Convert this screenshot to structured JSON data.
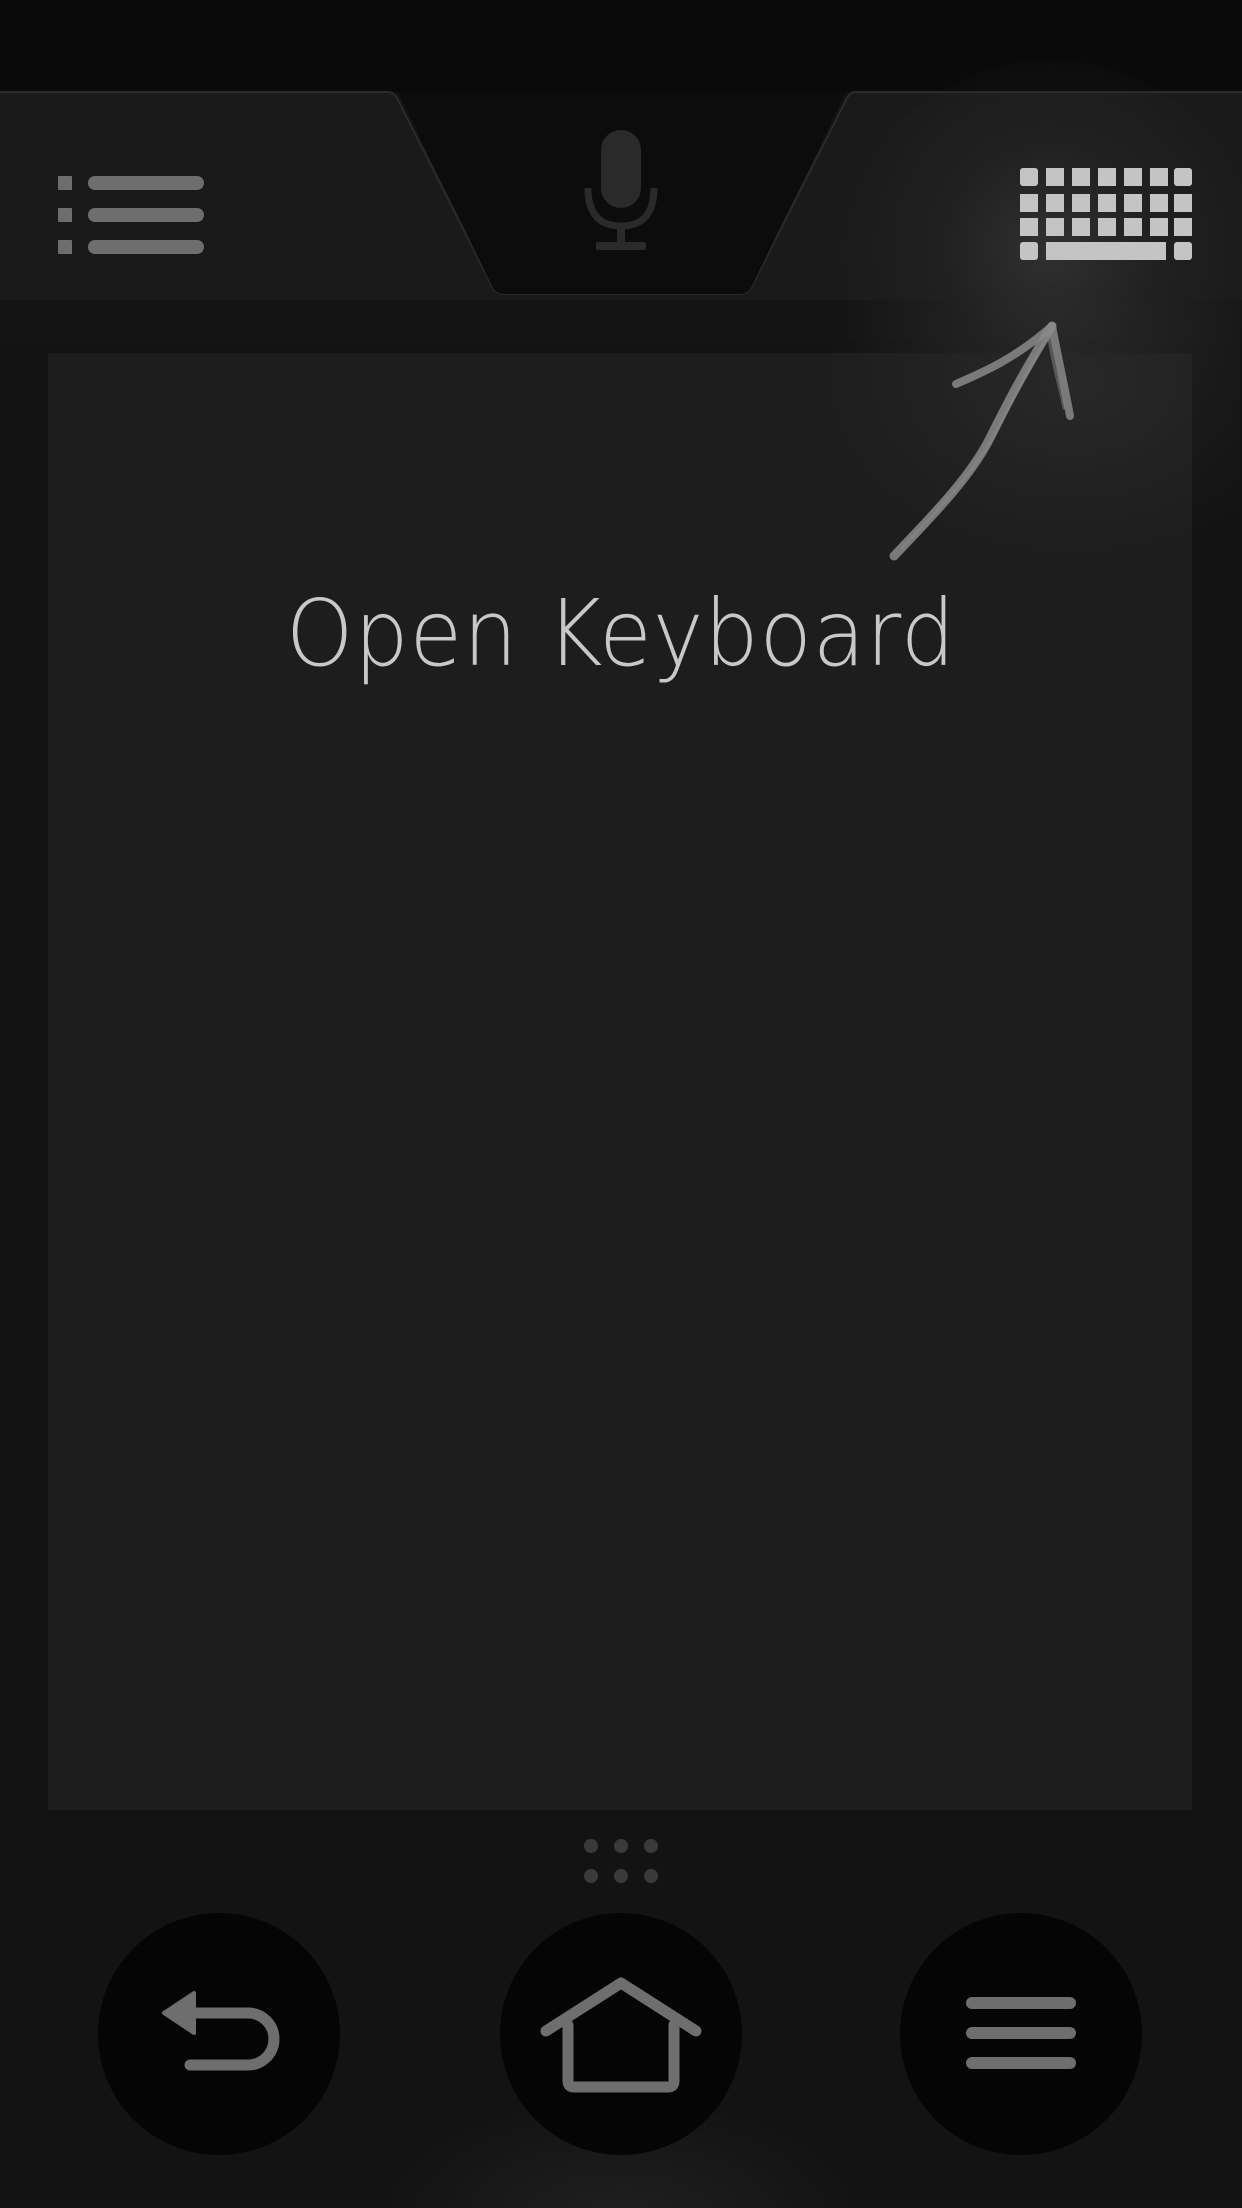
{
  "hint": {
    "text": "Open Keyboard"
  },
  "top_bar": {
    "left_icon": "list-icon",
    "center_icon": "microphone-icon",
    "right_icon": "keyboard-icon"
  },
  "nav_bar": {
    "back_icon": "back-arrow-icon",
    "home_icon": "home-icon",
    "menu_icon": "menu-icon"
  },
  "colors": {
    "background": "#131313",
    "touchpad": "#1d1d1d",
    "icon_gray": "#6e6e6e",
    "keyboard_icon": "#c4c4c4",
    "hint_text": "#c8c8c8"
  }
}
